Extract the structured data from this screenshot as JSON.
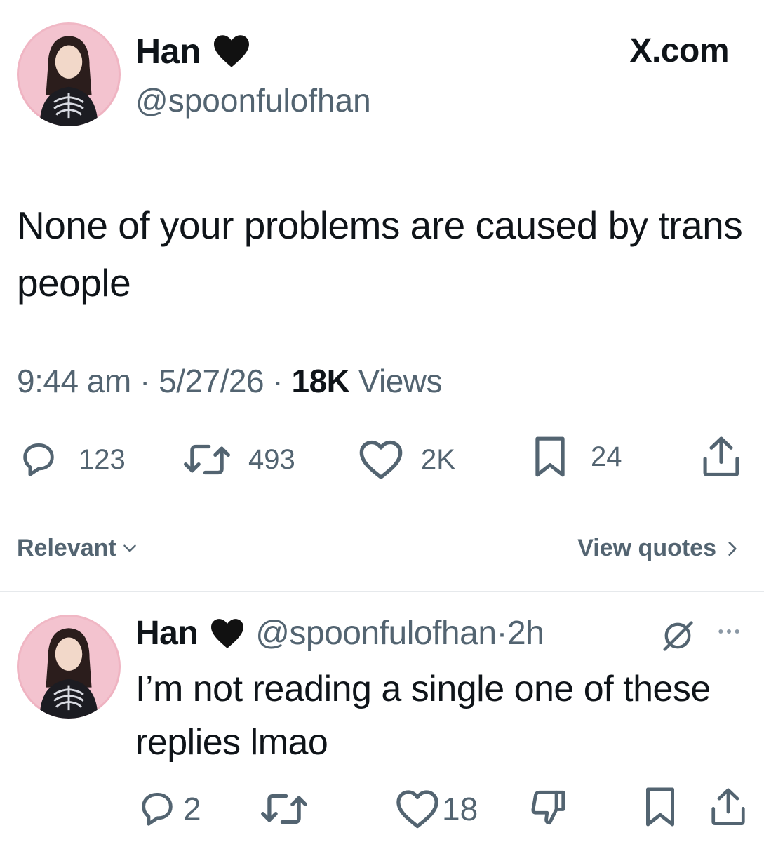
{
  "main_tweet": {
    "author_name": "Han",
    "handle": "@spoonfulofhan",
    "site_label": "X.com",
    "text": "None of your problems are caused by trans people",
    "time": "9:44 am",
    "date": "5/27/26",
    "views_count": "18K",
    "views_label": "Views",
    "separator": "·",
    "stats": {
      "replies": "123",
      "reposts": "493",
      "likes": "2K",
      "bookmarks": "24"
    }
  },
  "sort_bar": {
    "sort_label": "Relevant",
    "view_quotes_label": "View quotes"
  },
  "reply": {
    "author_name": "Han",
    "handle": "@spoonfulofhan",
    "separator": "·",
    "age": "2h",
    "text": "I’m not reading a single one of these replies lmao",
    "stats": {
      "replies": "2",
      "likes": "18"
    }
  },
  "icons": [
    "black-heart-icon",
    "reply-icon",
    "repost-icon",
    "like-icon",
    "bookmark-icon",
    "share-icon",
    "chevron-down-icon",
    "chevron-right-icon",
    "grok-icon",
    "more-icon",
    "dislike-icon"
  ],
  "colors": {
    "text_primary": "#0f1419",
    "text_secondary": "#536471",
    "divider": "#e6e9ec",
    "avatar_bg": "#f1b9c6"
  }
}
